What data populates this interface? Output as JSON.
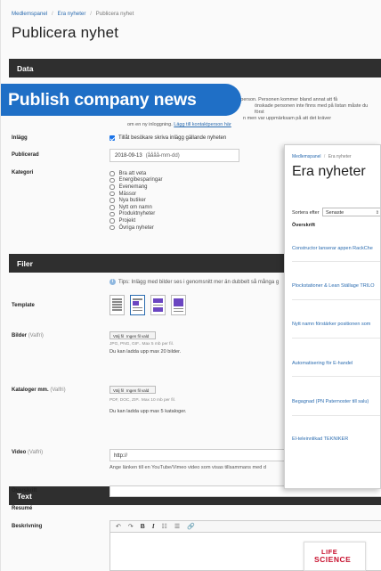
{
  "breadcrumb": [
    "Medlemspanel",
    "Era nyheter",
    "Publicera nyhet"
  ],
  "page_title": "Publicera nyhet",
  "banner": "Publish company news",
  "sections": {
    "data": "Data",
    "files": "Filer",
    "text": "Text"
  },
  "contact_info": {
    "line1": "ktperson. Personen kommer bland annat att få",
    "line2": "önskade personen inte finns med på listan måste du först",
    "line3": "n men var uppmärksam på att det kräver",
    "line4": "om en ny inloggning.",
    "link": "Lägg till kontaktperson här"
  },
  "fields": {
    "inlagg": "Inlägg",
    "publicerad": "Publicerad",
    "kategori": "Kategori",
    "template": "Template",
    "bilder": "Bilder",
    "kataloger": "Kataloger mm.",
    "video": "Video",
    "valfri": "(Valfri)",
    "overskrift": "Överskrift",
    "resume": "Resumé",
    "beskrivning": "Beskrivning"
  },
  "allow_comments": {
    "checked": true,
    "label": "Tillåt besökare skriva inlägg gällande nyheten"
  },
  "date": {
    "value": "2018-09-13",
    "hint": "(åååå-mm-dd)"
  },
  "categories": [
    "Bra att veta",
    "Energibesparingar",
    "Evenemang",
    "Mässor",
    "Nya butiker",
    "Nytt om namn",
    "Produktnyheter",
    "Projekt",
    "Övriga nyheter"
  ],
  "tip": "Tips: Inlägg med bilder ses i genomsnitt mer än dubbelt så många g",
  "file_button": {
    "choose": "Välj fil",
    "none": "Ingen fil vald"
  },
  "images_note_small": "JPG, PNG, GIF.. Max 5 mb per fil.",
  "images_note": "Du kan ladda upp max 20 bilder.",
  "catalogs_note_small": "PDF, DOC, ZIP.. Max 10 mb per fil.",
  "catalogs_note": "Du kan ladda upp max 5 kataloger.",
  "video": {
    "value": "http://",
    "note": "Ange länken till en YouTube/Vimeo video som visas tillsammans med d"
  },
  "editor_toolbar": [
    "↶",
    "↷",
    "B",
    "I",
    "☷",
    "☰",
    "🔗"
  ],
  "logo": {
    "line1": "LIFE",
    "line2": "SCIENCE",
    "swoosh": "~"
  },
  "overlay": {
    "breadcrumb": [
      "Medlemspanel",
      "Era nyheter"
    ],
    "title": "Era nyheter",
    "sort_label": "Sortera efter",
    "sort_value": "Senaste",
    "sort_caret": "⇕",
    "subtitle": "Överskrift",
    "items": [
      "Constructor lanserar appen RackChe",
      "Plockstationer & Lean Ställage TRILO",
      "Nytt namn förstärker positionen som",
      "Automatisering för E-handel",
      "Begagnad (PN Paternoster till salu)",
      "El-teleinnlikad TEKNIKER"
    ]
  }
}
